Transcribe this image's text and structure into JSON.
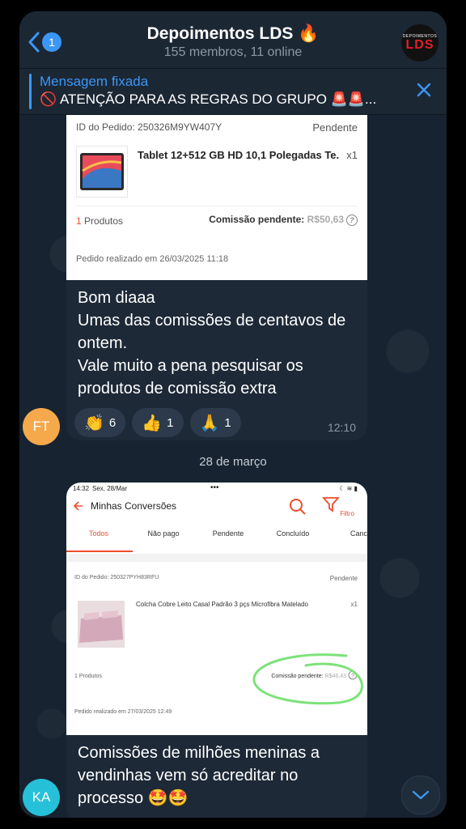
{
  "header": {
    "back_badge": "1",
    "title": "Depoimentos LDS 🔥",
    "subtitle": "155 membros, 11 online",
    "avatar_small": "DEPOIMENTOS",
    "avatar_big": "LDS"
  },
  "pinned": {
    "title": "Mensagem fixada",
    "text": "🚫 ATENÇÃO PARA AS REGRAS DO GRUPO 🚨🚨..."
  },
  "message1": {
    "order_id": "ID do Pedido: 250326M9YW407Y",
    "order_status": "Pendente",
    "product_name": "Tablet 12+512 GB HD 10,1 Polegadas Te...",
    "quantity": "x1",
    "products_count_num": "1",
    "products_count_label": "Produtos",
    "commission_label": "Comissão pendente:",
    "commission_value": "R$50,63",
    "order_date": "Pedido realizado em 26/03/2025 11:18",
    "text_lines": [
      "Bom diaaa",
      "Umas das comissões de centavos de",
      "ontem.",
      "Vale muito a pena pesquisar os",
      "produtos de comissão extra"
    ],
    "reactions": [
      {
        "emoji": "👏",
        "count": "6"
      },
      {
        "emoji": "👍",
        "count": "1"
      },
      {
        "emoji": "🙏",
        "count": "1"
      }
    ],
    "time": "12:10",
    "sender_initials": "FT"
  },
  "date_separator": "28 de março",
  "message2": {
    "status_time": "14:32",
    "status_date": "Sex, 28/Mar",
    "status_dots": "•••",
    "screen_title": "Minhas Conversões",
    "filter_label": "Filtro",
    "tabs": [
      "Todos",
      "Não pago",
      "Pendente",
      "Concluído",
      "Canc"
    ],
    "order_id": "ID do Pedido: 250327PYH83RFU",
    "order_status": "Pendente",
    "product_name": "Colcha Cobre Leito Casal Padrão 3 pçs Microfibra Matelado",
    "quantity": "x1",
    "products_count": "1 Produtos",
    "commission_label": "Comissão pendente:",
    "commission_value": "R$46,43",
    "order_date": "Pedido realizado em 27/03/2025 12:49",
    "text_lines": [
      "Comissões de milhões meninas a",
      "vendinhas vem só acreditar no",
      "processo 🤩🤩"
    ],
    "sender_initials": "KA"
  },
  "colors": {
    "accent": "#3a97f5",
    "shopee_orange": "#ee4d2d",
    "avatar_ft": "#f6a94b",
    "avatar_ka": "#26c1d8",
    "highlight_circle": "#7de27a"
  }
}
